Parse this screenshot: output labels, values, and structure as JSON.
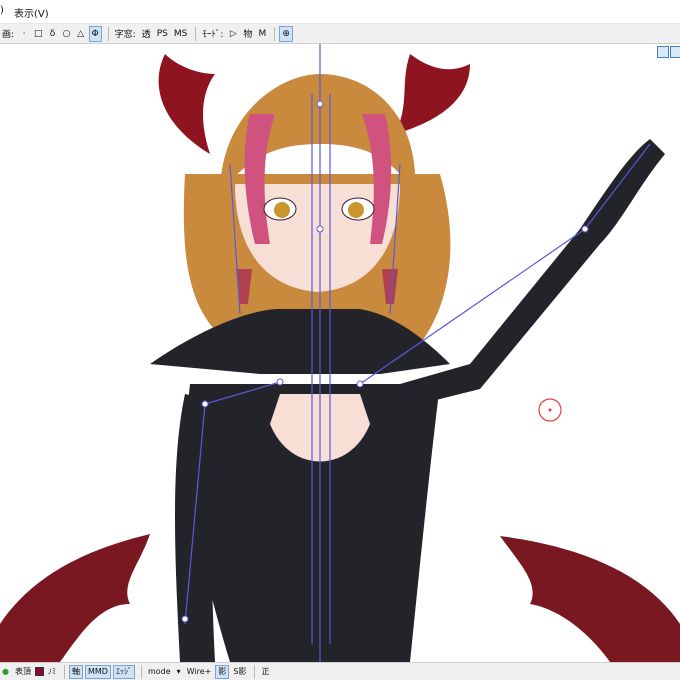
{
  "menubar": {
    "items": [
      ")",
      "表示(V)"
    ]
  },
  "toolbar": {
    "mode_label": "画:",
    "tools": [
      "·",
      "□",
      "δ",
      "○",
      "△",
      "Φ"
    ],
    "cursor_label": "字窓:",
    "transparent_label": "透",
    "ps_label": "PS",
    "ms_label": "MS",
    "mode_display_label": "ﾓｰﾄﾞ:",
    "play_icon": "▷",
    "physics_label": "物",
    "m_label": "M",
    "target_icon": "⊕"
  },
  "statusbar": {
    "expression_label": "表頂",
    "material_color": "#8b0a3a",
    "no_label": "ﾉﾐ",
    "axis_label": "軸",
    "mmd_label": "MMD",
    "edge_label": "ｴｯｼﾞ",
    "mode_select": "mode",
    "wire_label": "Wire+",
    "shadow_label": "影",
    "s_shadow_label": "S影",
    "front_label": "正"
  },
  "colors": {
    "hair_main": "#c98a3e",
    "hair_pink": "#d0527e",
    "horn": "#8e1420",
    "outfit": "#23232a",
    "skin": "#f7dfd6",
    "bone": "#5a5ad8",
    "wing": "#7a1822"
  }
}
